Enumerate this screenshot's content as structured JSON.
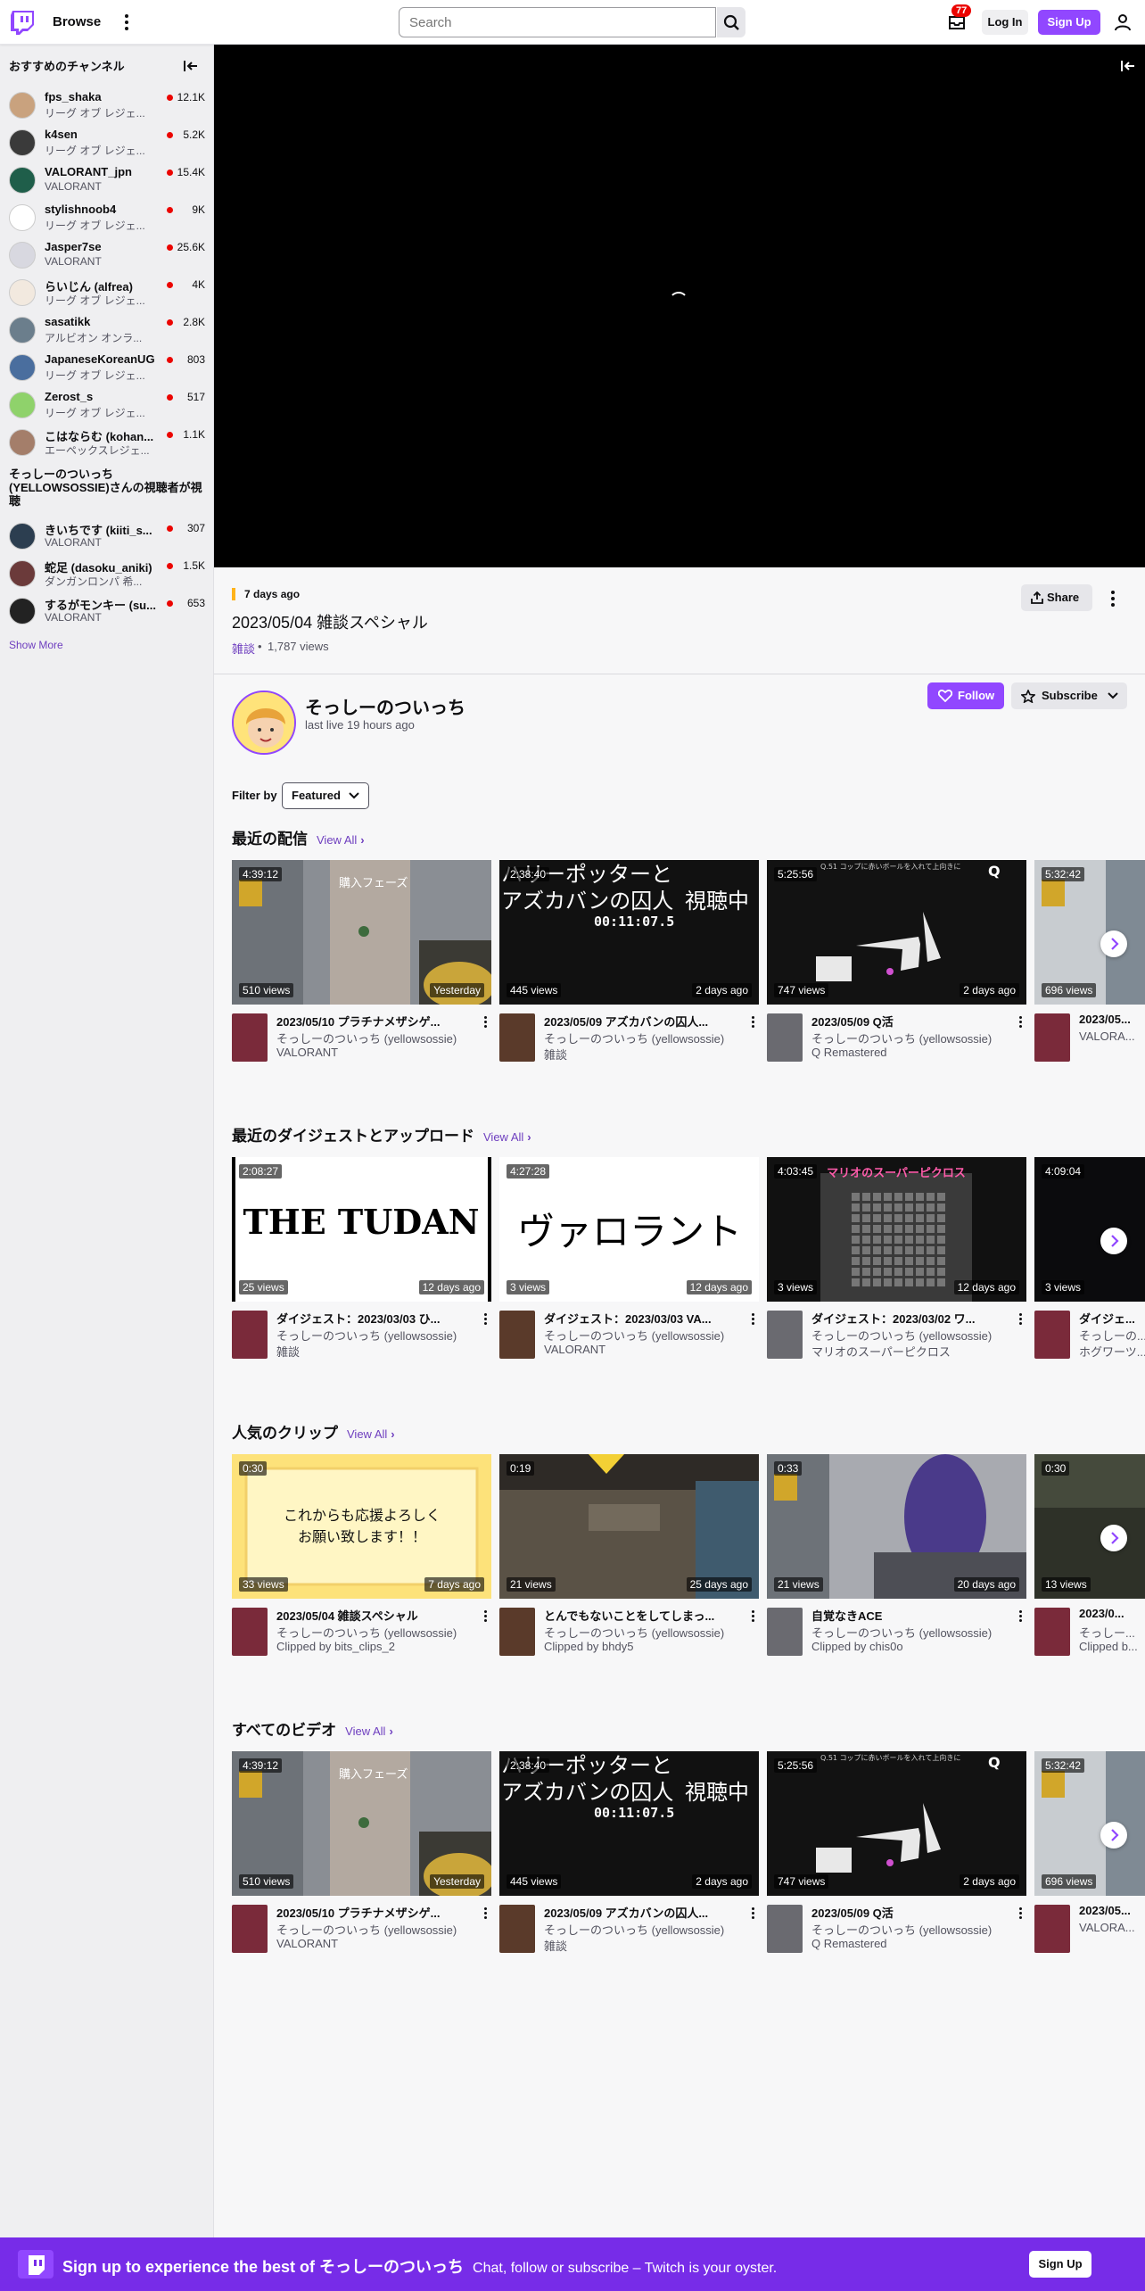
{
  "nav": {
    "browse": "Browse",
    "search_placeholder": "Search",
    "inbox_count": "77",
    "login": "Log In",
    "signup": "Sign Up"
  },
  "sidebar": {
    "recommended_title": "おすすめのチャンネル",
    "channels": [
      {
        "name": "fps_shaka",
        "game": "リーグ オブ レジェ...",
        "viewers": "12.1K",
        "color": "#c9a27e"
      },
      {
        "name": "k4sen",
        "game": "リーグ オブ レジェ...",
        "viewers": "5.2K",
        "color": "#3a3a3a"
      },
      {
        "name": "VALORANT_jpn",
        "game": "VALORANT",
        "viewers": "15.4K",
        "color": "#1f5e4a"
      },
      {
        "name": "stylishnoob4",
        "game": "リーグ オブ レジェ...",
        "viewers": "9K",
        "color": "#ffffff"
      },
      {
        "name": "Jasper7se",
        "game": "VALORANT",
        "viewers": "25.6K",
        "color": "#d8d8e0"
      },
      {
        "name": "らいじん (alfrea)",
        "game": "リーグ オブ レジェ...",
        "viewers": "4K",
        "color": "#f2e9df"
      },
      {
        "name": "sasatikk",
        "game": "アルビオン オンラ...",
        "viewers": "2.8K",
        "color": "#6b7e8c"
      },
      {
        "name": "JapaneseKoreanUG",
        "game": "リーグ オブ レジェ...",
        "viewers": "803",
        "color": "#4a6e9e"
      },
      {
        "name": "Zerost_s",
        "game": "リーグ オブ レジェ...",
        "viewers": "517",
        "color": "#8fd26b"
      },
      {
        "name": "こはならむ (kohan...",
        "game": "エーペックスレジェ...",
        "viewers": "1.1K",
        "color": "#a47e6a"
      }
    ],
    "viewers_also_title": "そっしーのついっち (YELLOWSOSSIE)さんの視聴者が視聴",
    "also": [
      {
        "name": "きいちです (kiiti_s...",
        "game": "VALORANT",
        "viewers": "307",
        "color": "#2c3e50"
      },
      {
        "name": "蛇足 (dasoku_aniki)",
        "game": "ダンガンロンパ 希...",
        "viewers": "1.5K",
        "color": "#6b3a3a"
      },
      {
        "name": "するがモンキー (su...",
        "game": "VALORANT",
        "viewers": "653",
        "color": "#222222"
      }
    ],
    "show_more": "Show More"
  },
  "video": {
    "ago": "7 days ago",
    "title": "2023/05/04 雑談スペシャル",
    "category": "雑談",
    "views": "1,787 views",
    "share": "Share"
  },
  "channel": {
    "name": "そっしーのついっち",
    "last_live": "last live 19 hours ago",
    "follow": "Follow",
    "subscribe": "Subscribe"
  },
  "filter": {
    "label": "Filter by",
    "value": "Featured"
  },
  "sections": [
    {
      "title": "最近の配信",
      "view_all": "View All",
      "cards": [
        {
          "length": "4:39:12",
          "views": "510 views",
          "date": "Yesterday",
          "title": "2023/05/10 プラチナメザシゲ...",
          "channel": "そっしーのついっち (yellowsossie)",
          "game": "VALORANT",
          "thumb": "val1"
        },
        {
          "length": "2:38:40",
          "views": "445 views",
          "date": "2 days ago",
          "title": "2023/05/09 アズカバンの囚人...",
          "channel": "そっしーのついっち (yellowsossie)",
          "game": "雑談",
          "thumb": "harry"
        },
        {
          "length": "5:25:56",
          "views": "747 views",
          "date": "2 days ago",
          "title": "2023/05/09 Q活",
          "channel": "そっしーのついっち (yellowsossie)",
          "game": "Q Remastered",
          "thumb": "q"
        },
        {
          "length": "5:32:42",
          "views": "696 views",
          "date": "",
          "title": "2023/05...",
          "channel": "VALORA...",
          "game": "",
          "thumb": "val2"
        }
      ]
    },
    {
      "title": "最近のダイジェストとアップロード",
      "view_all": "View All",
      "cards": [
        {
          "length": "2:08:27",
          "views": "25 views",
          "date": "12 days ago",
          "title": "ダイジェスト：2023/03/03 ひ...",
          "channel": "そっしーのついっち (yellowsossie)",
          "game": "雑談",
          "thumb": "tudan"
        },
        {
          "length": "4:27:28",
          "views": "3 views",
          "date": "12 days ago",
          "title": "ダイジェスト：2023/03/03 VA...",
          "channel": "そっしーのついっち (yellowsossie)",
          "game": "VALORANT",
          "thumb": "valo"
        },
        {
          "length": "4:03:45",
          "views": "3 views",
          "date": "12 days ago",
          "title": "ダイジェスト：2023/03/02 ワ...",
          "channel": "そっしーのついっち (yellowsossie)",
          "game": "マリオのスーパーピクロス",
          "thumb": "picross"
        },
        {
          "length": "4:09:04",
          "views": "3 views",
          "date": "",
          "title": "ダイジェ...",
          "channel": "そっしーの...",
          "game": "ホグワーツ...",
          "thumb": "dark"
        }
      ]
    },
    {
      "title": "人気のクリップ",
      "view_all": "View All",
      "cards": [
        {
          "length": "0:30",
          "views": "33 views",
          "date": "7 days ago",
          "title": "2023/05/04 雑談スペシャル",
          "channel": "そっしーのついっち (yellowsossie)",
          "game": "Clipped by bits_clips_2",
          "thumb": "note"
        },
        {
          "length": "0:19",
          "views": "21 views",
          "date": "25 days ago",
          "title": "とんでもないことをしてしまっ...",
          "channel": "そっしーのついっち (yellowsossie)",
          "game": "Clipped by bhdy5",
          "thumb": "room"
        },
        {
          "length": "0:33",
          "views": "21 views",
          "date": "20 days ago",
          "title": "自覚なきACE",
          "channel": "そっしーのついっち (yellowsossie)",
          "game": "Clipped by chis0o",
          "thumb": "ace"
        },
        {
          "length": "0:30",
          "views": "13 views",
          "date": "",
          "title": "2023/0...",
          "channel": "そっしー...",
          "game": "Clipped b...",
          "thumb": "soldier"
        }
      ]
    },
    {
      "title": "すべてのビデオ",
      "view_all": "View All",
      "cards": [
        {
          "length": "4:39:12",
          "views": "510 views",
          "date": "Yesterday",
          "title": "2023/05/10 プラチナメザシゲ...",
          "channel": "そっしーのついっち (yellowsossie)",
          "game": "VALORANT",
          "thumb": "val1"
        },
        {
          "length": "2:38:40",
          "views": "445 views",
          "date": "2 days ago",
          "title": "2023/05/09 アズカバンの囚人...",
          "channel": "そっしーのついっち (yellowsossie)",
          "game": "雑談",
          "thumb": "harry"
        },
        {
          "length": "5:25:56",
          "views": "747 views",
          "date": "2 days ago",
          "title": "2023/05/09 Q活",
          "channel": "そっしーのついっち (yellowsossie)",
          "game": "Q Remastered",
          "thumb": "q"
        },
        {
          "length": "5:32:42",
          "views": "696 views",
          "date": "",
          "title": "2023/05...",
          "channel": "VALORA...",
          "game": "",
          "thumb": "val2"
        }
      ]
    }
  ],
  "thumb_text": {
    "val1": "購入フェーズ",
    "harry_l1": "ハリーポッターと",
    "harry_l2": "アズカバンの囚人",
    "harry_live": "視聴中",
    "harry_time": "00:11:07.5",
    "q_hint": "Q.51 コップに赤いボールを入れて上向きに",
    "q_logo": "Q",
    "tudan": "THE TUDAN",
    "valo": "ヴァロラント",
    "picross_title": "マリオのスーパーピクロス",
    "note_l1": "これからも応援よろしく",
    "note_l2": "お願い致します！！"
  },
  "banner": {
    "main": "Sign up to experience the best of そっしーのついっち",
    "sub": "Chat, follow or subscribe – Twitch is your oyster.",
    "button": "Sign Up"
  },
  "colors": {
    "accent": "#9147ff",
    "live": "#eb0400",
    "banner": "#772ce8"
  }
}
